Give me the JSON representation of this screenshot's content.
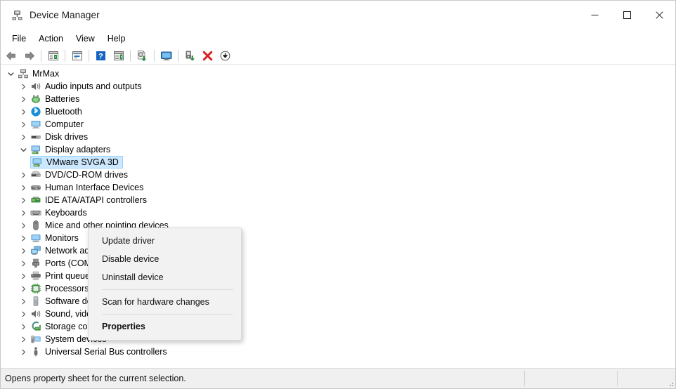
{
  "window": {
    "title": "Device Manager",
    "title_icon": "device-manager-icon",
    "controls": [
      {
        "name": "minimize-button",
        "glyph": "minimize"
      },
      {
        "name": "maximize-button",
        "glyph": "maximize"
      },
      {
        "name": "close-button",
        "glyph": "close"
      }
    ]
  },
  "menubar": {
    "items": [
      {
        "label": "File"
      },
      {
        "label": "Action"
      },
      {
        "label": "View"
      },
      {
        "label": "Help"
      }
    ]
  },
  "toolbar": {
    "buttons": [
      {
        "name": "back-button",
        "icon": "back-arrow-icon"
      },
      {
        "name": "forward-button",
        "icon": "forward-arrow-icon"
      },
      {
        "name": "separator-1",
        "icon": "separator"
      },
      {
        "name": "show-hide-console-tree-button",
        "icon": "console-tree-icon"
      },
      {
        "name": "separator-2",
        "icon": "separator"
      },
      {
        "name": "properties-button",
        "icon": "properties-window-icon"
      },
      {
        "name": "separator-3",
        "icon": "separator"
      },
      {
        "name": "help-button",
        "icon": "help-question-icon"
      },
      {
        "name": "show-hide-action-pane-button",
        "icon": "action-pane-icon"
      },
      {
        "name": "separator-4",
        "icon": "separator"
      },
      {
        "name": "update-driver-button",
        "icon": "update-driver-icon"
      },
      {
        "name": "separator-5",
        "icon": "separator"
      },
      {
        "name": "scan-hardware-changes-button",
        "icon": "scan-monitor-icon"
      },
      {
        "name": "separator-6",
        "icon": "separator"
      },
      {
        "name": "enable-device-button",
        "icon": "enable-device-icon"
      },
      {
        "name": "uninstall-device-button",
        "icon": "red-x-icon"
      },
      {
        "name": "disable-device-button",
        "icon": "down-arrow-circle-icon"
      }
    ]
  },
  "tree": {
    "root": {
      "label": "MrMax",
      "icon": "computer-root-icon",
      "expanded": true
    },
    "nodes": [
      {
        "label": "Audio inputs and outputs",
        "icon": "speaker-icon",
        "expanded": false,
        "level": 1,
        "selected": false
      },
      {
        "label": "Batteries",
        "icon": "battery-icon",
        "expanded": false,
        "level": 1,
        "selected": false
      },
      {
        "label": "Bluetooth",
        "icon": "bluetooth-icon",
        "expanded": false,
        "level": 1,
        "selected": false
      },
      {
        "label": "Computer",
        "icon": "computer-icon",
        "expanded": false,
        "level": 1,
        "selected": false
      },
      {
        "label": "Disk drives",
        "icon": "disk-drive-icon",
        "expanded": false,
        "level": 1,
        "selected": false
      },
      {
        "label": "Display adapters",
        "icon": "display-adapter-icon",
        "expanded": true,
        "level": 1,
        "selected": false
      },
      {
        "label": "VMware SVGA 3D",
        "icon": "display-adapter-icon",
        "expanded": null,
        "level": 2,
        "selected": true
      },
      {
        "label": "DVD/CD-ROM drives",
        "icon": "dvd-drive-icon",
        "expanded": false,
        "level": 1,
        "selected": false
      },
      {
        "label": "Human Interface Devices",
        "icon": "hid-icon",
        "expanded": false,
        "level": 1,
        "selected": false
      },
      {
        "label": "IDE ATA/ATAPI controllers",
        "icon": "ide-controller-icon",
        "expanded": false,
        "level": 1,
        "selected": false
      },
      {
        "label": "Keyboards",
        "icon": "keyboard-icon",
        "expanded": false,
        "level": 1,
        "selected": false
      },
      {
        "label": "Mice and other pointing devices",
        "icon": "mouse-icon",
        "expanded": false,
        "level": 1,
        "selected": false
      },
      {
        "label": "Monitors",
        "icon": "monitor-icon",
        "expanded": false,
        "level": 1,
        "selected": false
      },
      {
        "label": "Network adapters",
        "icon": "network-adapter-icon",
        "expanded": false,
        "level": 1,
        "selected": false
      },
      {
        "label": "Ports (COM & LPT)",
        "icon": "port-icon",
        "expanded": false,
        "level": 1,
        "selected": false
      },
      {
        "label": "Print queues",
        "icon": "printer-icon",
        "expanded": false,
        "level": 1,
        "selected": false
      },
      {
        "label": "Processors",
        "icon": "processor-icon",
        "expanded": false,
        "level": 1,
        "selected": false
      },
      {
        "label": "Software devices",
        "icon": "software-device-icon",
        "expanded": false,
        "level": 1,
        "selected": false
      },
      {
        "label": "Sound, video and game controllers",
        "icon": "speaker-icon",
        "expanded": false,
        "level": 1,
        "selected": false
      },
      {
        "label": "Storage controllers",
        "icon": "storage-controller-icon",
        "expanded": false,
        "level": 1,
        "selected": false
      },
      {
        "label": "System devices",
        "icon": "system-device-icon",
        "expanded": false,
        "level": 1,
        "selected": false
      },
      {
        "label": "Universal Serial Bus controllers",
        "icon": "usb-icon",
        "expanded": false,
        "level": 1,
        "selected": false
      }
    ]
  },
  "context_menu": {
    "visible": true,
    "items": [
      {
        "label": "Update driver",
        "bold": false,
        "type": "item",
        "name": "ctx-update-driver"
      },
      {
        "label": "Disable device",
        "bold": false,
        "type": "item",
        "name": "ctx-disable-device"
      },
      {
        "label": "Uninstall device",
        "bold": false,
        "type": "item",
        "name": "ctx-uninstall-device"
      },
      {
        "type": "separator"
      },
      {
        "label": "Scan for hardware changes",
        "bold": false,
        "type": "item",
        "name": "ctx-scan-hardware-changes"
      },
      {
        "type": "separator"
      },
      {
        "label": "Properties",
        "bold": true,
        "type": "item",
        "name": "ctx-properties"
      }
    ]
  },
  "statusbar": {
    "text": "Opens property sheet for the current selection."
  },
  "colors": {
    "selection_fill": "#cce8ff",
    "selection_border": "#99d1ff",
    "menu_background": "#f2f2f2",
    "status_background": "#f0f0f0",
    "close_hover": "#e81123"
  }
}
